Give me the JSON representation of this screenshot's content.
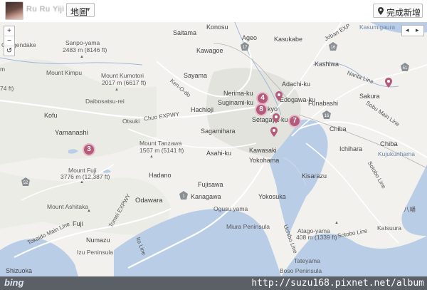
{
  "header": {
    "username": "Ru Ru Yiji",
    "view_label": "地圖",
    "done_label": "完成新增"
  },
  "map": {
    "labels": [
      {
        "id": "konosu",
        "text": "Konosu"
      },
      {
        "id": "ageo",
        "text": "Ageo"
      },
      {
        "id": "kasukabe",
        "text": "Kasukabe"
      },
      {
        "id": "kasumigaura",
        "text": "Kasumigaura"
      },
      {
        "id": "saitama",
        "text": "Saitama"
      },
      {
        "id": "sanpo",
        "text": "Sanpo-yama"
      },
      {
        "id": "sanpo_h",
        "text": "2483 m (8146 ft)"
      },
      {
        "id": "gongendake",
        "text": "Gongendake"
      },
      {
        "id": "kawagoe",
        "text": "Kawagoe"
      },
      {
        "id": "kashiwa",
        "text": "Kashiwa"
      },
      {
        "id": "mtkimpu",
        "text": "Mount Kimpu"
      },
      {
        "id": "mtkumotori",
        "text": "Mount Kumotori"
      },
      {
        "id": "kumotori_h",
        "text": "2017 m (6617 ft)"
      },
      {
        "id": "sayama",
        "text": "Sayama"
      },
      {
        "id": "adachi",
        "text": "Adachi-ku"
      },
      {
        "id": "sakura",
        "text": "Sakura"
      },
      {
        "id": "nerima",
        "text": "Nerima-ku"
      },
      {
        "id": "daibo",
        "text": "Daibosatsu-rei"
      },
      {
        "id": "hachioji",
        "text": "Hachioji"
      },
      {
        "id": "suginami",
        "text": "Suginami-ku"
      },
      {
        "id": "tokyo",
        "text": "kyo"
      },
      {
        "id": "edogawa",
        "text": "Edogawa-ku"
      },
      {
        "id": "funabashi",
        "text": "Funabashi"
      },
      {
        "id": "kofu",
        "text": "Kofu"
      },
      {
        "id": "otsuki",
        "text": "Otsuki"
      },
      {
        "id": "setagaya",
        "text": "Setagaya-ku"
      },
      {
        "id": "yamanashi",
        "text": "Yamanashi"
      },
      {
        "id": "sagamihara",
        "text": "Sagamihara"
      },
      {
        "id": "chiba",
        "text": "Chiba"
      },
      {
        "id": "chiba2",
        "text": "Chiba"
      },
      {
        "id": "mttanzawa",
        "text": "Mount Tanzawa"
      },
      {
        "id": "tanzawa_h",
        "text": "1567 m (5141 ft)"
      },
      {
        "id": "asahi",
        "text": "Asahi-ku"
      },
      {
        "id": "kawasaki",
        "text": "Kawasaki"
      },
      {
        "id": "ichihara",
        "text": "Ichihara"
      },
      {
        "id": "kujukuri",
        "text": "Kujukurihama"
      },
      {
        "id": "yokohama",
        "text": "Yokohama"
      },
      {
        "id": "mtfuji",
        "text": "Mount Fuji"
      },
      {
        "id": "fuji_h",
        "text": "3776 m (12,387 ft)"
      },
      {
        "id": "hadano",
        "text": "Hadano"
      },
      {
        "id": "kisarazu",
        "text": "Kisarazu"
      },
      {
        "id": "fujisawa",
        "text": "Fujisawa"
      },
      {
        "id": "odawara",
        "text": "Odawara"
      },
      {
        "id": "kanagawa",
        "text": "Kanagawa"
      },
      {
        "id": "yokosuka",
        "text": "Yokosuka"
      },
      {
        "id": "ogusu",
        "text": "Ogusu yama"
      },
      {
        "id": "mtashitaka",
        "text": "Mount Ashitaka"
      },
      {
        "id": "fuji",
        "text": "Fuji"
      },
      {
        "id": "miura",
        "text": "Miura Peninsula"
      },
      {
        "id": "kagatsu",
        "text": "Katsuura"
      },
      {
        "id": "atago",
        "text": "Atago-yama"
      },
      {
        "id": "atago_h",
        "text": "408 m (1339 ft)"
      },
      {
        "id": "numazu",
        "text": "Numazu"
      },
      {
        "id": "izu",
        "text": "Izu Peninsula"
      },
      {
        "id": "tateyama",
        "text": "Tateyama"
      },
      {
        "id": "shizuoka",
        "text": "Shizuoka"
      },
      {
        "id": "boso",
        "text": "Boso Peninsula"
      },
      {
        "id": "hachiman",
        "text": "八幡"
      },
      {
        "id": "x74",
        "text": "74 ft)"
      },
      {
        "id": "xm",
        "text": "m"
      }
    ],
    "roads": [
      {
        "id": "chuo",
        "text": "Chuo EXPWY"
      },
      {
        "id": "kenodo",
        "text": "Ken-O-do"
      },
      {
        "id": "joban",
        "text": "Joban EXP"
      },
      {
        "id": "narita",
        "text": "Narita Line"
      },
      {
        "id": "sobu",
        "text": "Sobu Main Line"
      },
      {
        "id": "sotobo",
        "text": "Sotobo Line"
      },
      {
        "id": "uchibo",
        "text": "Uchibo Line"
      },
      {
        "id": "tomei",
        "text": "Tomei EXPWY"
      },
      {
        "id": "tokaido",
        "text": "Tokaido Main Line"
      },
      {
        "id": "ito",
        "text": "Ito Line"
      },
      {
        "id": "sotobo2",
        "text": "Sotobo Line"
      }
    ],
    "route_badges": [
      "17",
      "16",
      "51",
      "52",
      "1",
      "16"
    ],
    "markers": [
      {
        "id": "m3",
        "count": "3"
      },
      {
        "id": "m4",
        "count": "4"
      },
      {
        "id": "m8",
        "count": "8"
      },
      {
        "id": "m7",
        "count": "7"
      }
    ],
    "pins": [
      "pin-north",
      "pin-setagaya",
      "pin-sakura",
      "pin-yokohama"
    ],
    "controls": {
      "zoom_in": "+",
      "zoom_out": "−",
      "reset": "↺",
      "prev": "◂",
      "next": "▸"
    },
    "colors": {
      "land": "#f2f1ee",
      "water": "#b9cde6",
      "marker": "#b45b7c",
      "marker_ring": "#e7b9ca"
    }
  },
  "footer": {
    "logo": "bing",
    "watermark": "http://suzu168.pixnet.net/album"
  }
}
